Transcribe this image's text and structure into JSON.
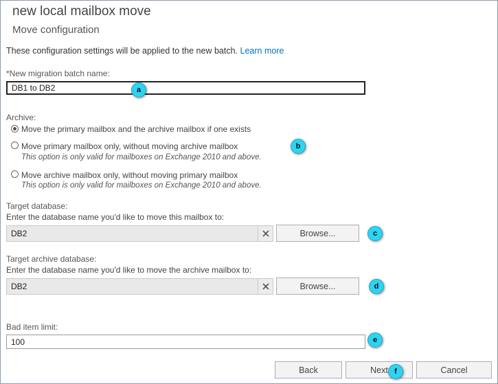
{
  "header": {
    "title": "new local mailbox move",
    "subtitle": "Move configuration"
  },
  "intro": {
    "text": "These configuration settings will be applied to the new batch.",
    "learn_more": "Learn more"
  },
  "batch_name": {
    "label": "*New migration batch name:",
    "value": "DB1 to DB2"
  },
  "archive": {
    "label": "Archive:",
    "options": [
      {
        "label": "Move the primary mailbox and the archive mailbox if one exists",
        "note": "",
        "selected": true
      },
      {
        "label": "Move primary mailbox only, without moving archive mailbox",
        "note": "This option is only valid for mailboxes on Exchange 2010 and above.",
        "selected": false
      },
      {
        "label": "Move archive mailbox only, without moving primary mailbox",
        "note": "This option is only valid for mailboxes on Exchange 2010 and above.",
        "selected": false
      }
    ]
  },
  "target_database": {
    "label": "Target database:",
    "hint": "Enter the database name you'd like to move this mailbox to:",
    "value": "DB2",
    "clear_icon": "close-icon",
    "browse_label": "Browse..."
  },
  "target_archive_database": {
    "label": "Target archive database:",
    "hint": "Enter the database name you'd like to move the archive mailbox to:",
    "value": "DB2",
    "clear_icon": "close-icon",
    "browse_label": "Browse..."
  },
  "bad_item_limit": {
    "label": "Bad item limit:",
    "value": "100"
  },
  "footer": {
    "back_label": "Back",
    "next_label": "Next",
    "cancel_label": "Cancel"
  },
  "callouts": [
    "a",
    "b",
    "c",
    "d",
    "e",
    "f"
  ],
  "colors": {
    "accent": "#0072c6",
    "callout": "#2fd3f2"
  }
}
